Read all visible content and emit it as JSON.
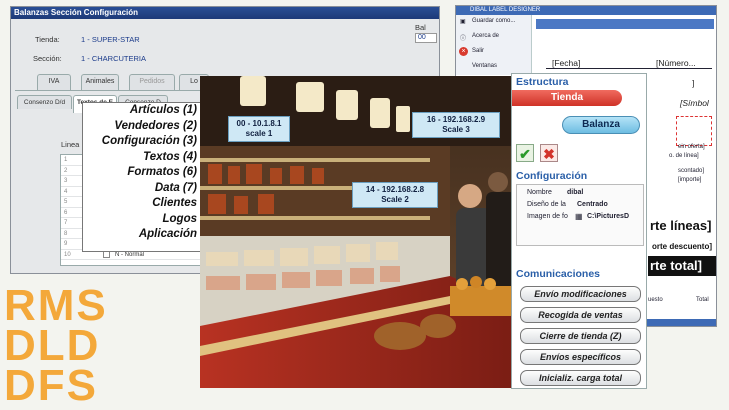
{
  "config_window": {
    "title": "Balanzas Sección Configuración",
    "tienda_label": "Tienda:",
    "tienda_value": "1 - SUPER-STAR",
    "seccion_label": "Sección:",
    "seccion_value": "1 - CHARCUTERIA",
    "tabs": [
      "IVA",
      "Animales",
      "Pedidos",
      "Lo"
    ],
    "subtabs": [
      "Consenzo D/d",
      "Textos de E",
      "Consenzo D"
    ],
    "lines_label": "Linea",
    "row_numbers": [
      "1",
      "2",
      "3",
      "4",
      "5",
      "6",
      "7",
      "8",
      "9",
      "10"
    ],
    "last_row_value": "N - Normal",
    "side_label": "Bal",
    "side_value": "00"
  },
  "menu": {
    "items": [
      "Artículos (1)",
      "Vendedores (2)",
      "Configuración (3)",
      "Textos (4)",
      "Formatos (6)",
      "Data (7)",
      "Clientes",
      "Logos",
      "Aplicación"
    ]
  },
  "designer_window": {
    "title": "DIBAL LABEL DESIGNER",
    "menu_items": [
      "Guardar como...",
      "Acerca de",
      "Salir",
      "Ventanas"
    ],
    "fields": [
      "[Fecha]",
      "[Número...",
      "]",
      "[Símbol"
    ],
    "mini_texts": [
      "ein oferta]",
      "o. de línea]",
      "scontado]",
      "[importe]"
    ],
    "total_lines": "rte líneas]",
    "discount": "orte descuento]",
    "total": "rte total]",
    "footer_left": "uesto",
    "footer_right": "Total"
  },
  "photo_labels": [
    {
      "id": "00 - 10.1.8.1",
      "name": "scale 1"
    },
    {
      "id": "16 - 192.168.2.9",
      "name": "Scale 3"
    },
    {
      "id": "14 - 192.168.2.8",
      "name": "Scale 2"
    }
  ],
  "structure_panel": {
    "heading": "Estructura",
    "tienda_btn": "Tienda",
    "balanza_btn": "Balanza",
    "config_heading": "Configuración",
    "nombre_label": "Nombre",
    "nombre_value": "dibal",
    "diseno_label": "Diseño de la",
    "diseno_value": "Centrado",
    "imagen_label": "Imagen de fo",
    "imagen_value": "C:\\PicturesD",
    "comms_heading": "Comunicaciones",
    "buttons": [
      "Envío modificaciones",
      "Recogida de ventas",
      "Cierre de tienda (Z)",
      "Envíos específicos",
      "Inicializ. carga total"
    ]
  },
  "brand": {
    "lines": [
      "RMS",
      "DLD",
      "DFS"
    ]
  },
  "colors": {
    "title_bar": "#1d3a78",
    "tienda_red": "#e2453c",
    "balanza_blue": "#7ec3e6",
    "brand_orange": "#f3a83a",
    "section_blue": "#2a5fa8"
  }
}
